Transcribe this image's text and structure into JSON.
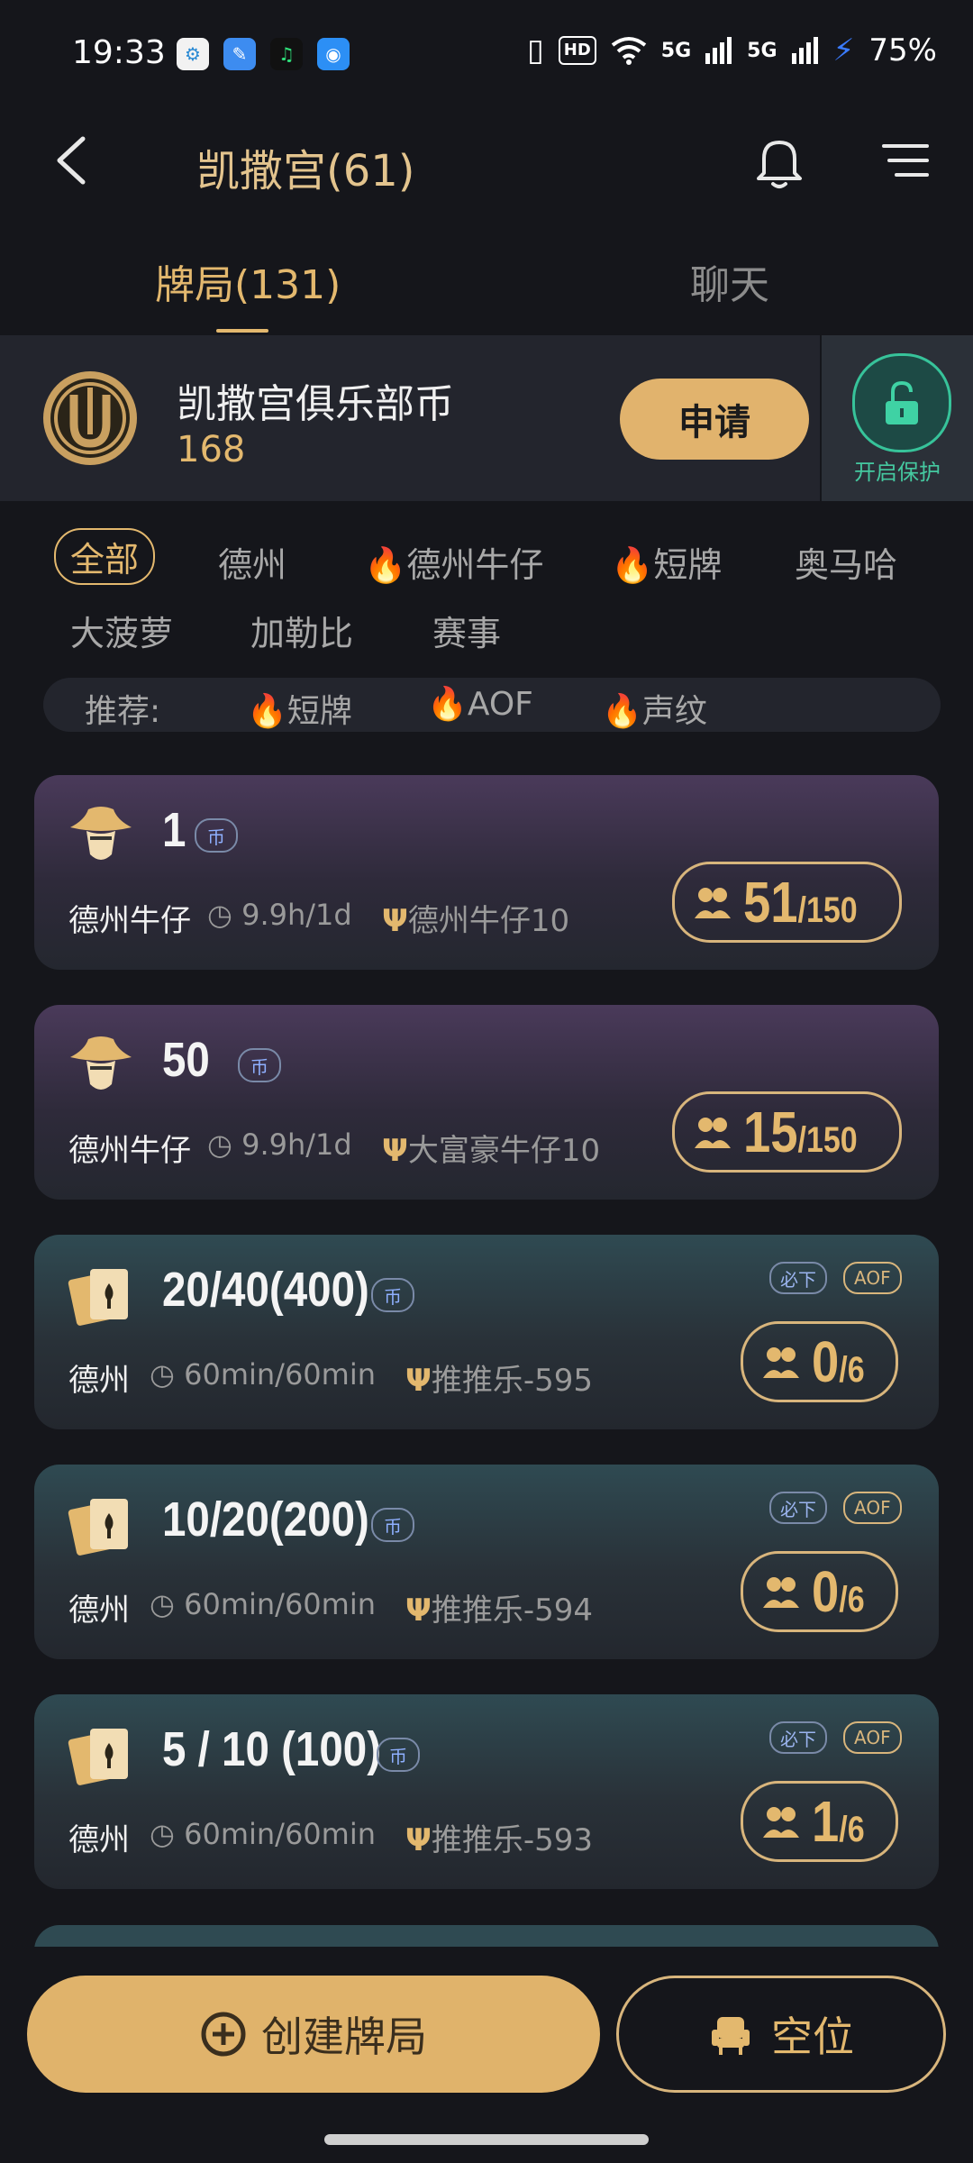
{
  "status_bar": {
    "time": "19:33",
    "network_1": "5G",
    "network_2": "5G",
    "battery": "75%",
    "hd": "HD"
  },
  "header": {
    "title": "凯撒宫(61)"
  },
  "tabs": [
    {
      "label": "牌局(131)",
      "active": true
    },
    {
      "label": "聊天",
      "active": false
    }
  ],
  "coin_panel": {
    "name": "凯撒宫俱乐部币",
    "amount": "168",
    "apply_label": "申请",
    "protect_label": "开启保护"
  },
  "filters": [
    {
      "label": "全部",
      "active": true,
      "hot": false
    },
    {
      "label": "德州",
      "active": false,
      "hot": false
    },
    {
      "label": "德州牛仔",
      "active": false,
      "hot": true
    },
    {
      "label": "短牌",
      "active": false,
      "hot": true
    },
    {
      "label": "奥马哈",
      "active": false,
      "hot": false
    },
    {
      "label": "大菠萝",
      "active": false,
      "hot": false
    },
    {
      "label": "加勒比",
      "active": false,
      "hot": false
    },
    {
      "label": "赛事",
      "active": false,
      "hot": false
    }
  ],
  "recommend": {
    "label": "推荐:",
    "items": [
      "短牌",
      "AOF",
      "声纹"
    ]
  },
  "coin_tag": "币",
  "tables": [
    {
      "stake": "1",
      "game": "德州牛仔",
      "duration": "9.9h/1d",
      "host": "德州牛仔10",
      "seated": "51",
      "max": "/150",
      "theme": "purple",
      "icon": "cowboy-icon",
      "badges": []
    },
    {
      "stake": "50",
      "game": "德州牛仔",
      "duration": "9.9h/1d",
      "host": "大富豪牛仔10",
      "seated": "15",
      "max": "/150",
      "theme": "purple",
      "icon": "cowboy-icon",
      "badges": []
    },
    {
      "stake": "20/40(400)",
      "game": "德州",
      "duration": "60min/60min",
      "host": "推推乐-595",
      "seated": "0",
      "max": "/6",
      "theme": "teal",
      "icon": "cards-icon",
      "badges": [
        "必下",
        "AOF"
      ]
    },
    {
      "stake": "10/20(200)",
      "game": "德州",
      "duration": "60min/60min",
      "host": "推推乐-594",
      "seated": "0",
      "max": "/6",
      "theme": "teal",
      "icon": "cards-icon",
      "badges": [
        "必下",
        "AOF"
      ]
    },
    {
      "stake": "5 / 10 (100)",
      "game": "德州",
      "duration": "60min/60min",
      "host": "推推乐-593",
      "seated": "1",
      "max": "/6",
      "theme": "teal",
      "icon": "cards-icon",
      "badges": [
        "必下",
        "AOF"
      ]
    }
  ],
  "bottom": {
    "create_label": "创建牌局",
    "empty_label": "空位"
  }
}
